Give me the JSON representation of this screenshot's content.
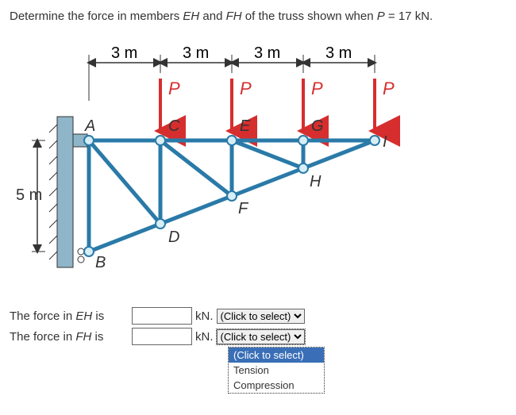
{
  "question_prefix": "Determine the force in members ",
  "member1": "EH",
  "question_mid1": " and ",
  "member2": "FH",
  "question_mid2": " of the truss shown when ",
  "pvar": "P",
  "question_eq": " = 17 kN.",
  "dims": {
    "d1": "3 m",
    "d2": "3 m",
    "d3": "3 m",
    "d4": "3 m",
    "height": "5 m"
  },
  "loads": {
    "p1": "P",
    "p2": "P",
    "p3": "P",
    "p4": "P"
  },
  "nodes": {
    "A": "A",
    "B": "B",
    "C": "C",
    "D": "D",
    "E": "E",
    "F": "F",
    "G": "G",
    "H": "H",
    "I": "I"
  },
  "answers": {
    "eh_label_pre": "The force in ",
    "eh_member": "EH",
    "eh_label_post": " is",
    "eh_value": "",
    "eh_unit": "kN.",
    "eh_select_placeholder": "(Click to select)",
    "fh_label_pre": "The force in ",
    "fh_member": "FH",
    "fh_label_post": " is",
    "fh_value": "",
    "fh_unit": "kN.",
    "fh_select_placeholder": "(Click to select)"
  },
  "dropdown_options": {
    "placeholder": "(Click to select)",
    "opt1": "Tension",
    "opt2": "Compression"
  },
  "chart_data": {
    "type": "diagram",
    "description": "Cantilever truss with pin at A and roller at B on a wall at the left. Top chord nodes A,C,E,G,I spaced 3 m apart. Bottom chord node B at 5 m below A, diagonals meet at D,F,H. Downward loads P applied at C,E,G,I.",
    "P_kN": 17,
    "bay_spacing_m": [
      3,
      3,
      3,
      3
    ],
    "wall_height_m": 5,
    "top_nodes": [
      "A",
      "C",
      "E",
      "G",
      "I"
    ],
    "bottom_nodes": [
      "B",
      "D",
      "F",
      "H"
    ],
    "loads_at": [
      "C",
      "E",
      "G",
      "I"
    ],
    "supports": {
      "A": "pin",
      "B": "roller"
    }
  }
}
